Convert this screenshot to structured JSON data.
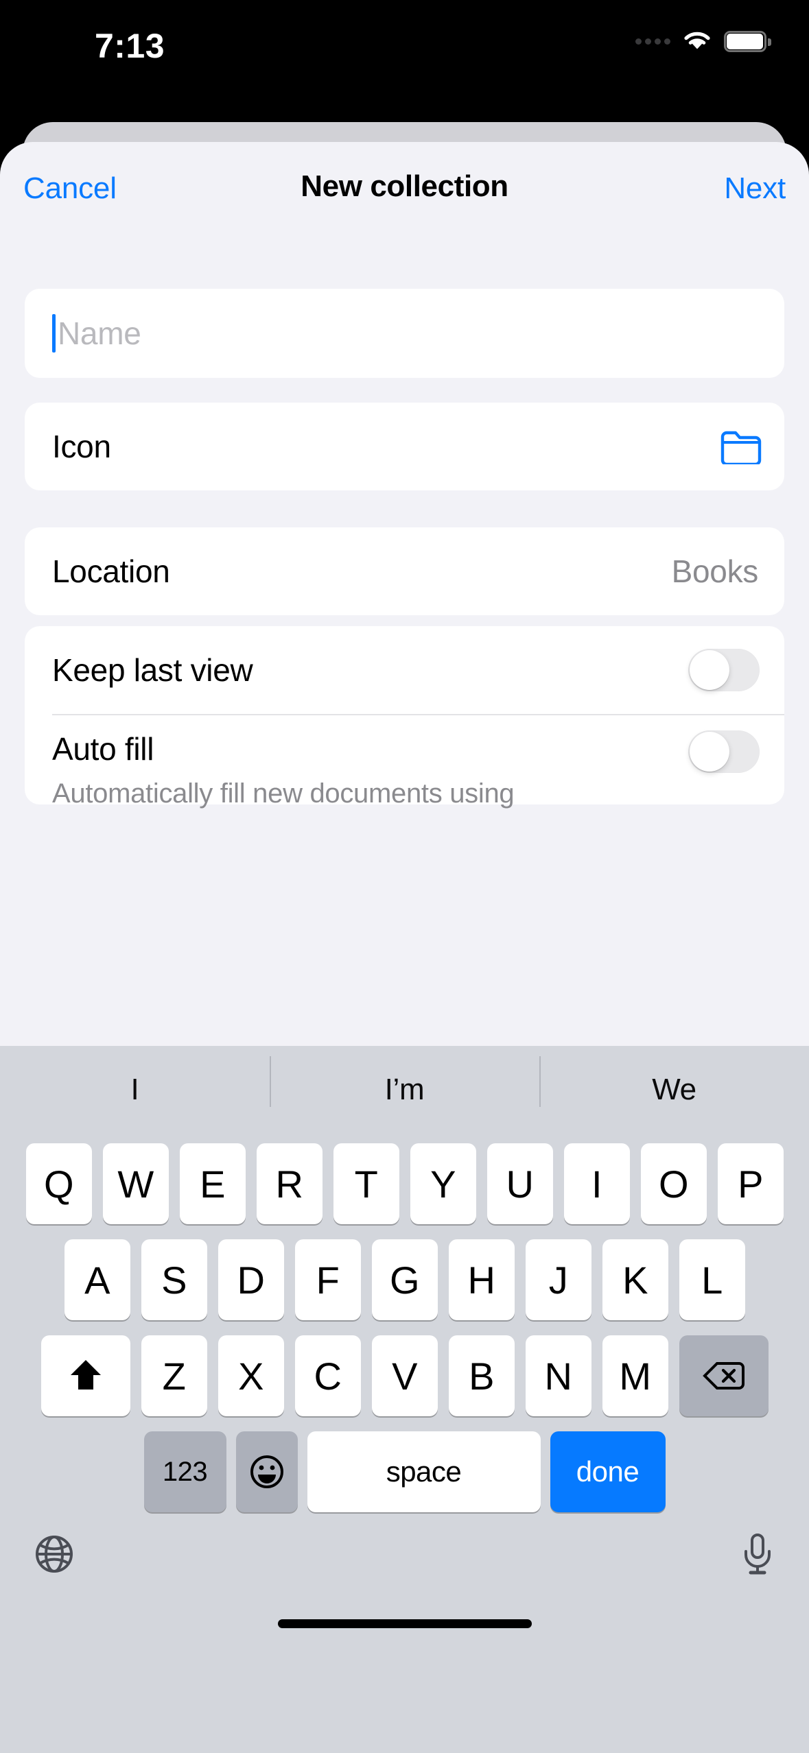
{
  "status_bar": {
    "time": "7:13",
    "cellular_icon": "cellular-dots-icon",
    "wifi_icon": "wifi-icon",
    "battery_icon": "battery-icon"
  },
  "nav": {
    "cancel_label": "Cancel",
    "title": "New collection",
    "next_label": "Next"
  },
  "form": {
    "name_field": {
      "value": "",
      "placeholder": "Name"
    },
    "icon_row": {
      "label": "Icon",
      "icon": "folder-icon"
    },
    "location_row": {
      "label": "Location",
      "value": "Books"
    },
    "keep_last_view": {
      "label": "Keep last view",
      "state": "off"
    },
    "auto_fill": {
      "label": "Auto fill",
      "description": "Automatically fill new documents using",
      "state": "off"
    }
  },
  "keyboard": {
    "predictions": [
      "I",
      "I’m",
      "We"
    ],
    "row1": [
      "Q",
      "W",
      "E",
      "R",
      "T",
      "Y",
      "U",
      "I",
      "O",
      "P"
    ],
    "row2": [
      "A",
      "S",
      "D",
      "F",
      "G",
      "H",
      "J",
      "K",
      "L"
    ],
    "row3_letters": [
      "Z",
      "X",
      "C",
      "V",
      "B",
      "N",
      "M"
    ],
    "shift_icon": "shift-up-arrow-icon",
    "delete_icon": "delete-backspace-icon",
    "numbers_label": "123",
    "emoji_icon": "emoji-smiley-icon",
    "space_label": "space",
    "return_label": "done",
    "globe_icon": "globe-icon",
    "mic_icon": "microphone-icon"
  },
  "colors": {
    "accent_blue": "#0a7aff",
    "return_blue": "#067aff",
    "sheet_bg": "#f2f2f7",
    "card_bg": "#ffffff",
    "keyboard_bg": "#d3d6dc",
    "key_bg": "#ffffff",
    "modifier_key_bg": "#acb0ba",
    "switch_off_track": "#e9e9eb",
    "secondary_text": "#8a8a8e"
  }
}
